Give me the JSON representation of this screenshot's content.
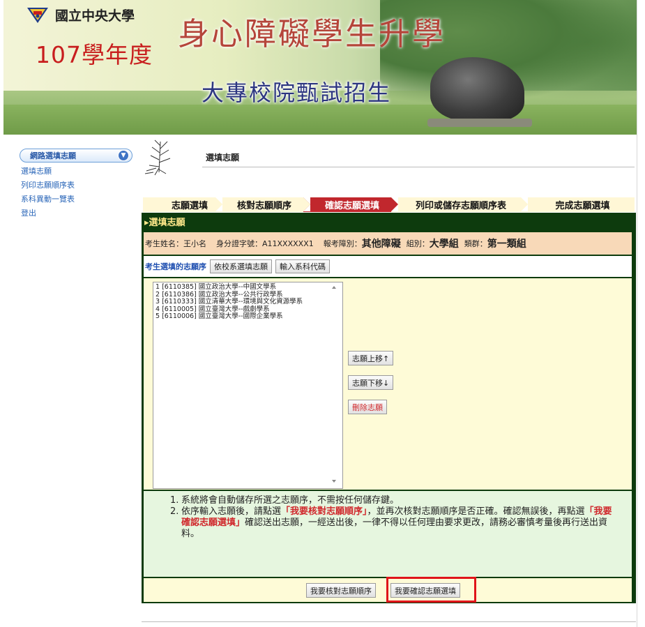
{
  "banner": {
    "university": "國立中央大學",
    "year": "107學年度",
    "title_main": "身心障礙學生升學",
    "title_sub": "大專校院甄試招生"
  },
  "sidebar": {
    "header": "網路選填志願",
    "links": [
      "選填志願",
      "列印志願順序表",
      "系科異動一覽表",
      "登出"
    ]
  },
  "page": {
    "title": "選填志願"
  },
  "steps": [
    {
      "label": "志願選填",
      "active": false
    },
    {
      "label": "核對志願順序",
      "active": false
    },
    {
      "label": "確認志願選填",
      "active": true
    },
    {
      "label": "列印或儲存志願順序表",
      "active": false
    },
    {
      "label": "完成志願選填",
      "active": false
    }
  ],
  "panel": {
    "title": "▸選填志願",
    "info": {
      "name_label": "考生姓名：",
      "name_value": "王小名",
      "id_label": "身分證字號：",
      "id_value": "A11XXXXXX1",
      "category_label": "報考障別：",
      "category_value": "其他障礙",
      "group_label": "組別：",
      "group_value": "大學組",
      "cluster_label": "類群：",
      "cluster_value": "第一類組"
    },
    "choice_label": "考生選填的志願序",
    "choice_buttons": [
      "依校系選填志願",
      "輸入系科代碼"
    ],
    "choices": [
      "1 [6110385] 國立政治大學--中國文學系",
      "2 [6110386] 國立政治大學--公共行政學系",
      "3 [6110333] 國立清華大學--環境與文化資源學系",
      "4 [6110005] 國立臺灣大學--戲劇學系",
      "5 [6110006] 國立臺灣大學--國際企業學系"
    ],
    "move_up": "志願上移↑",
    "move_down": "志願下移↓",
    "delete": "刪除志願",
    "notes": {
      "n1": "1.",
      "t1": "系統將會自動儲存所選之志願序，不需按任何儲存鍵。",
      "n2": "2.",
      "t2a": "依序輸入志願後，請點選",
      "t2b": "「我要核對志願順序」",
      "t2c": "，並再次核對志願順序是否正確。確認無誤後，再點選",
      "t2d": "「我要確認志願選填」",
      "t2e": "確認送出志願，一經送出後，一律不得以任何理由要求更改，請務必審慎考量後再行送出資料。"
    },
    "check_button": "我要核對志願順序",
    "confirm_button": "我要確認志願選填"
  },
  "colors": {
    "panel_bg": "#0d3b0d",
    "active_step": "#c1272d",
    "highlight": "#e0141a",
    "link": "#2a66b8"
  }
}
